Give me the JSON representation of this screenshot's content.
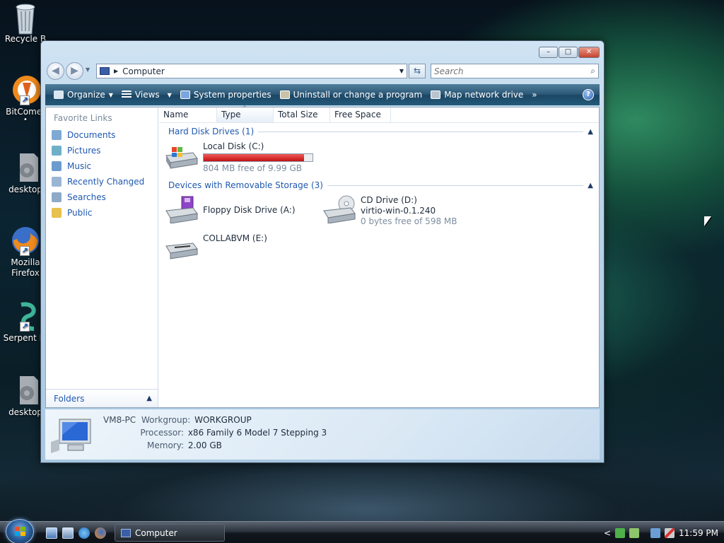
{
  "desktop": {
    "icons": [
      {
        "label": "Recycle B",
        "icon": "recycle-bin-icon"
      },
      {
        "label": "BitComet",
        "icon": "bitcomet-icon"
      },
      {
        "label": "desktop",
        "icon": "settings-file-icon"
      },
      {
        "label": "Mozilla Firefox",
        "icon": "firefox-icon"
      },
      {
        "label": "Serpent IA",
        "icon": "serpent-icon"
      },
      {
        "label": "desktop",
        "icon": "settings-file-icon"
      }
    ]
  },
  "window": {
    "title": "Computer",
    "caption": {
      "minimize": "–",
      "maximize": "□",
      "close": "✕"
    },
    "address": "Computer",
    "search_placeholder": "Search",
    "toolbar": {
      "organize": "Organize",
      "views": "Views",
      "system_properties": "System properties",
      "uninstall": "Uninstall or change a program",
      "map_drive": "Map network drive",
      "more": "»",
      "help": "?"
    },
    "nav": {
      "header": "Favorite Links",
      "items": [
        "Documents",
        "Pictures",
        "Music",
        "Recently Changed",
        "Searches",
        "Public"
      ],
      "folders": "Folders"
    },
    "columns": [
      "Name",
      "Type",
      "Total Size",
      "Free Space"
    ],
    "groups": {
      "hdd": "Hard Disk Drives (1)",
      "removable": "Devices with Removable Storage (3)"
    },
    "drives": {
      "c": {
        "name": "Local Disk (C:)",
        "free": "804 MB free of 9.99 GB",
        "used_fraction": 0.92
      },
      "a": {
        "name": "Floppy Disk Drive (A:)"
      },
      "d": {
        "name": "CD Drive (D:)",
        "label": "virtio-win-0.1.240",
        "free": "0 bytes free of 598 MB"
      },
      "e": {
        "name": "COLLABVM (E:)"
      }
    },
    "details": {
      "computer_name": "VM8-PC",
      "workgroup_label": "Workgroup:",
      "workgroup": "WORKGROUP",
      "processor_label": "Processor:",
      "processor": "x86 Family 6 Model 7 Stepping 3",
      "memory_label": "Memory:",
      "memory": "2.00 GB"
    }
  },
  "taskbar": {
    "task_label": "Computer",
    "tray_expand": "<",
    "time": "11:59 PM"
  }
}
